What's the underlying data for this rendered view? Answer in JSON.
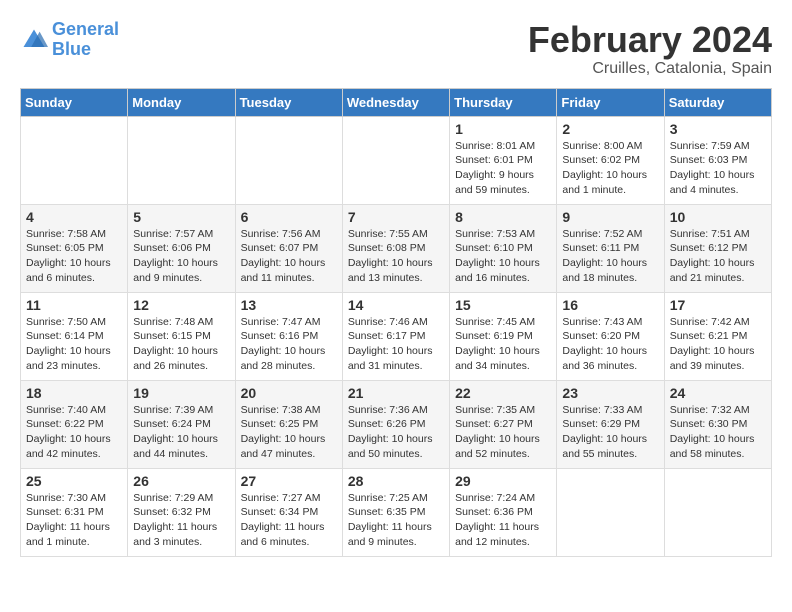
{
  "header": {
    "logo_line1": "General",
    "logo_line2": "Blue",
    "title": "February 2024",
    "subtitle": "Cruilles, Catalonia, Spain"
  },
  "calendar": {
    "days_of_week": [
      "Sunday",
      "Monday",
      "Tuesday",
      "Wednesday",
      "Thursday",
      "Friday",
      "Saturday"
    ],
    "weeks": [
      [
        {
          "num": "",
          "info": ""
        },
        {
          "num": "",
          "info": ""
        },
        {
          "num": "",
          "info": ""
        },
        {
          "num": "",
          "info": ""
        },
        {
          "num": "1",
          "info": "Sunrise: 8:01 AM\nSunset: 6:01 PM\nDaylight: 9 hours\nand 59 minutes."
        },
        {
          "num": "2",
          "info": "Sunrise: 8:00 AM\nSunset: 6:02 PM\nDaylight: 10 hours\nand 1 minute."
        },
        {
          "num": "3",
          "info": "Sunrise: 7:59 AM\nSunset: 6:03 PM\nDaylight: 10 hours\nand 4 minutes."
        }
      ],
      [
        {
          "num": "4",
          "info": "Sunrise: 7:58 AM\nSunset: 6:05 PM\nDaylight: 10 hours\nand 6 minutes."
        },
        {
          "num": "5",
          "info": "Sunrise: 7:57 AM\nSunset: 6:06 PM\nDaylight: 10 hours\nand 9 minutes."
        },
        {
          "num": "6",
          "info": "Sunrise: 7:56 AM\nSunset: 6:07 PM\nDaylight: 10 hours\nand 11 minutes."
        },
        {
          "num": "7",
          "info": "Sunrise: 7:55 AM\nSunset: 6:08 PM\nDaylight: 10 hours\nand 13 minutes."
        },
        {
          "num": "8",
          "info": "Sunrise: 7:53 AM\nSunset: 6:10 PM\nDaylight: 10 hours\nand 16 minutes."
        },
        {
          "num": "9",
          "info": "Sunrise: 7:52 AM\nSunset: 6:11 PM\nDaylight: 10 hours\nand 18 minutes."
        },
        {
          "num": "10",
          "info": "Sunrise: 7:51 AM\nSunset: 6:12 PM\nDaylight: 10 hours\nand 21 minutes."
        }
      ],
      [
        {
          "num": "11",
          "info": "Sunrise: 7:50 AM\nSunset: 6:14 PM\nDaylight: 10 hours\nand 23 minutes."
        },
        {
          "num": "12",
          "info": "Sunrise: 7:48 AM\nSunset: 6:15 PM\nDaylight: 10 hours\nand 26 minutes."
        },
        {
          "num": "13",
          "info": "Sunrise: 7:47 AM\nSunset: 6:16 PM\nDaylight: 10 hours\nand 28 minutes."
        },
        {
          "num": "14",
          "info": "Sunrise: 7:46 AM\nSunset: 6:17 PM\nDaylight: 10 hours\nand 31 minutes."
        },
        {
          "num": "15",
          "info": "Sunrise: 7:45 AM\nSunset: 6:19 PM\nDaylight: 10 hours\nand 34 minutes."
        },
        {
          "num": "16",
          "info": "Sunrise: 7:43 AM\nSunset: 6:20 PM\nDaylight: 10 hours\nand 36 minutes."
        },
        {
          "num": "17",
          "info": "Sunrise: 7:42 AM\nSunset: 6:21 PM\nDaylight: 10 hours\nand 39 minutes."
        }
      ],
      [
        {
          "num": "18",
          "info": "Sunrise: 7:40 AM\nSunset: 6:22 PM\nDaylight: 10 hours\nand 42 minutes."
        },
        {
          "num": "19",
          "info": "Sunrise: 7:39 AM\nSunset: 6:24 PM\nDaylight: 10 hours\nand 44 minutes."
        },
        {
          "num": "20",
          "info": "Sunrise: 7:38 AM\nSunset: 6:25 PM\nDaylight: 10 hours\nand 47 minutes."
        },
        {
          "num": "21",
          "info": "Sunrise: 7:36 AM\nSunset: 6:26 PM\nDaylight: 10 hours\nand 50 minutes."
        },
        {
          "num": "22",
          "info": "Sunrise: 7:35 AM\nSunset: 6:27 PM\nDaylight: 10 hours\nand 52 minutes."
        },
        {
          "num": "23",
          "info": "Sunrise: 7:33 AM\nSunset: 6:29 PM\nDaylight: 10 hours\nand 55 minutes."
        },
        {
          "num": "24",
          "info": "Sunrise: 7:32 AM\nSunset: 6:30 PM\nDaylight: 10 hours\nand 58 minutes."
        }
      ],
      [
        {
          "num": "25",
          "info": "Sunrise: 7:30 AM\nSunset: 6:31 PM\nDaylight: 11 hours\nand 1 minute."
        },
        {
          "num": "26",
          "info": "Sunrise: 7:29 AM\nSunset: 6:32 PM\nDaylight: 11 hours\nand 3 minutes."
        },
        {
          "num": "27",
          "info": "Sunrise: 7:27 AM\nSunset: 6:34 PM\nDaylight: 11 hours\nand 6 minutes."
        },
        {
          "num": "28",
          "info": "Sunrise: 7:25 AM\nSunset: 6:35 PM\nDaylight: 11 hours\nand 9 minutes."
        },
        {
          "num": "29",
          "info": "Sunrise: 7:24 AM\nSunset: 6:36 PM\nDaylight: 11 hours\nand 12 minutes."
        },
        {
          "num": "",
          "info": ""
        },
        {
          "num": "",
          "info": ""
        }
      ]
    ]
  }
}
